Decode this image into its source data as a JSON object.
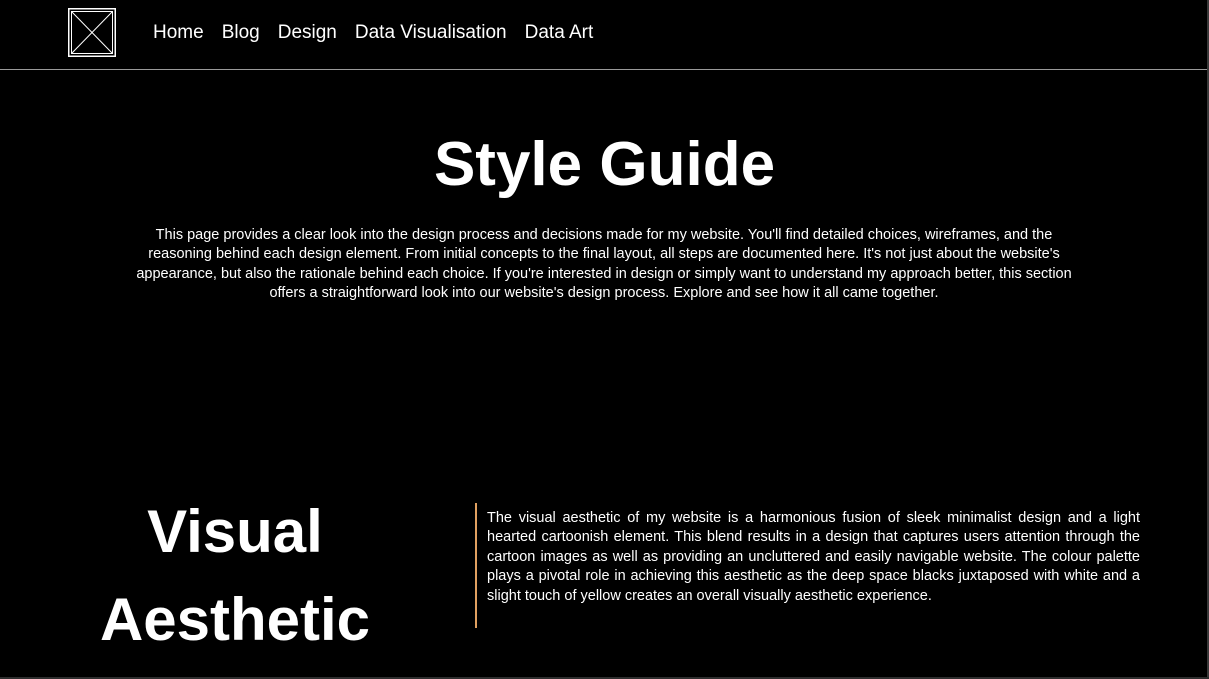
{
  "nav": {
    "logo_icon": "image-placeholder-icon",
    "links": [
      "Home",
      "Blog",
      "Design",
      "Data Visualisation",
      "Data Art"
    ]
  },
  "main": {
    "title": "Style Guide",
    "intro": "This page provides a clear look into the design process and decisions made for my website. You'll find detailed choices, wireframes, and the reasoning behind each design element. From initial concepts to the final layout, all steps are documented here. It's not just about the website's appearance, but also the rationale behind each choice. If you're interested in design or simply want to understand my approach better, this section offers a straightforward look into our website's design process. Explore and see how it all came together."
  },
  "section": {
    "title": "Visual Aesthetic",
    "body": "The visual aesthetic of my website is a harmonious fusion of sleek minimalist design and a light hearted cartoonish element. This blend results in a design that captures users attention through the cartoon images as well as providing an uncluttered and easily navigable website. The colour palette plays a pivotal role in achieving this aesthetic as the deep space blacks juxtaposed with white and a slight touch of yellow creates an overall visually aesthetic experience."
  },
  "colors": {
    "background": "#000000",
    "text": "#ffffff",
    "accent_divider": "#e0a060",
    "nav_border": "#9a9a9a"
  }
}
